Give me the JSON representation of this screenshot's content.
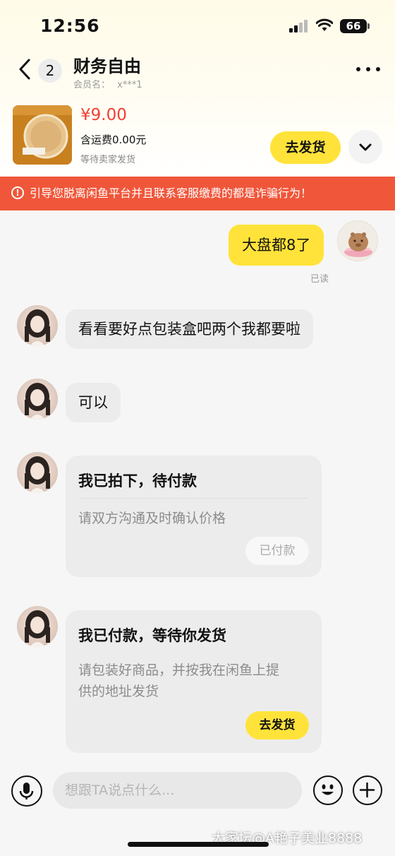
{
  "status_bar": {
    "time": "12:56",
    "battery": "66"
  },
  "header": {
    "back_icon": "chevron-left-icon",
    "unread_count": "2",
    "title": "财务自由",
    "member_label": "会员名：",
    "member_name": "x***1",
    "more_icon": "more-dots-icon"
  },
  "product": {
    "price": "¥9.00",
    "shipping": "含运费0.00元",
    "status": "等待卖家发货",
    "ship_button": "去发货",
    "expand_icon": "chevron-down-icon"
  },
  "warning": {
    "icon": "alert-circle-icon",
    "text": "引导您脱离闲鱼平台并且联系客服缴费的都是诈骗行为！",
    "background": "#f0563a"
  },
  "messages": [
    {
      "from": "me",
      "text": "大盘都8了",
      "status": "已读"
    },
    {
      "from": "them",
      "text": "看看要好点包装盒吧两个我都要啦"
    },
    {
      "from": "them",
      "text": "可以"
    }
  ],
  "cards": [
    {
      "title": "我已拍下，待付款",
      "desc_lines": [
        "请双方沟通及时确认价格"
      ],
      "button": "已付款"
    },
    {
      "title": "我已付款，等待你发货",
      "desc_lines": [
        "请包装好商品，并按我在闲鱼上提",
        "供的地址发货"
      ],
      "button": "去发货"
    }
  ],
  "input_bar": {
    "placeholder": "想跟TA说点什么...",
    "mic_icon": "microphone-icon",
    "emoji_icon": "smiley-icon",
    "plus_icon": "plus-icon"
  },
  "watermark": "大家坛@A艳子美业8888",
  "colors": {
    "accent_yellow": "#ffe33a",
    "price_red": "#f24033",
    "warning_orange": "#f0563a"
  }
}
